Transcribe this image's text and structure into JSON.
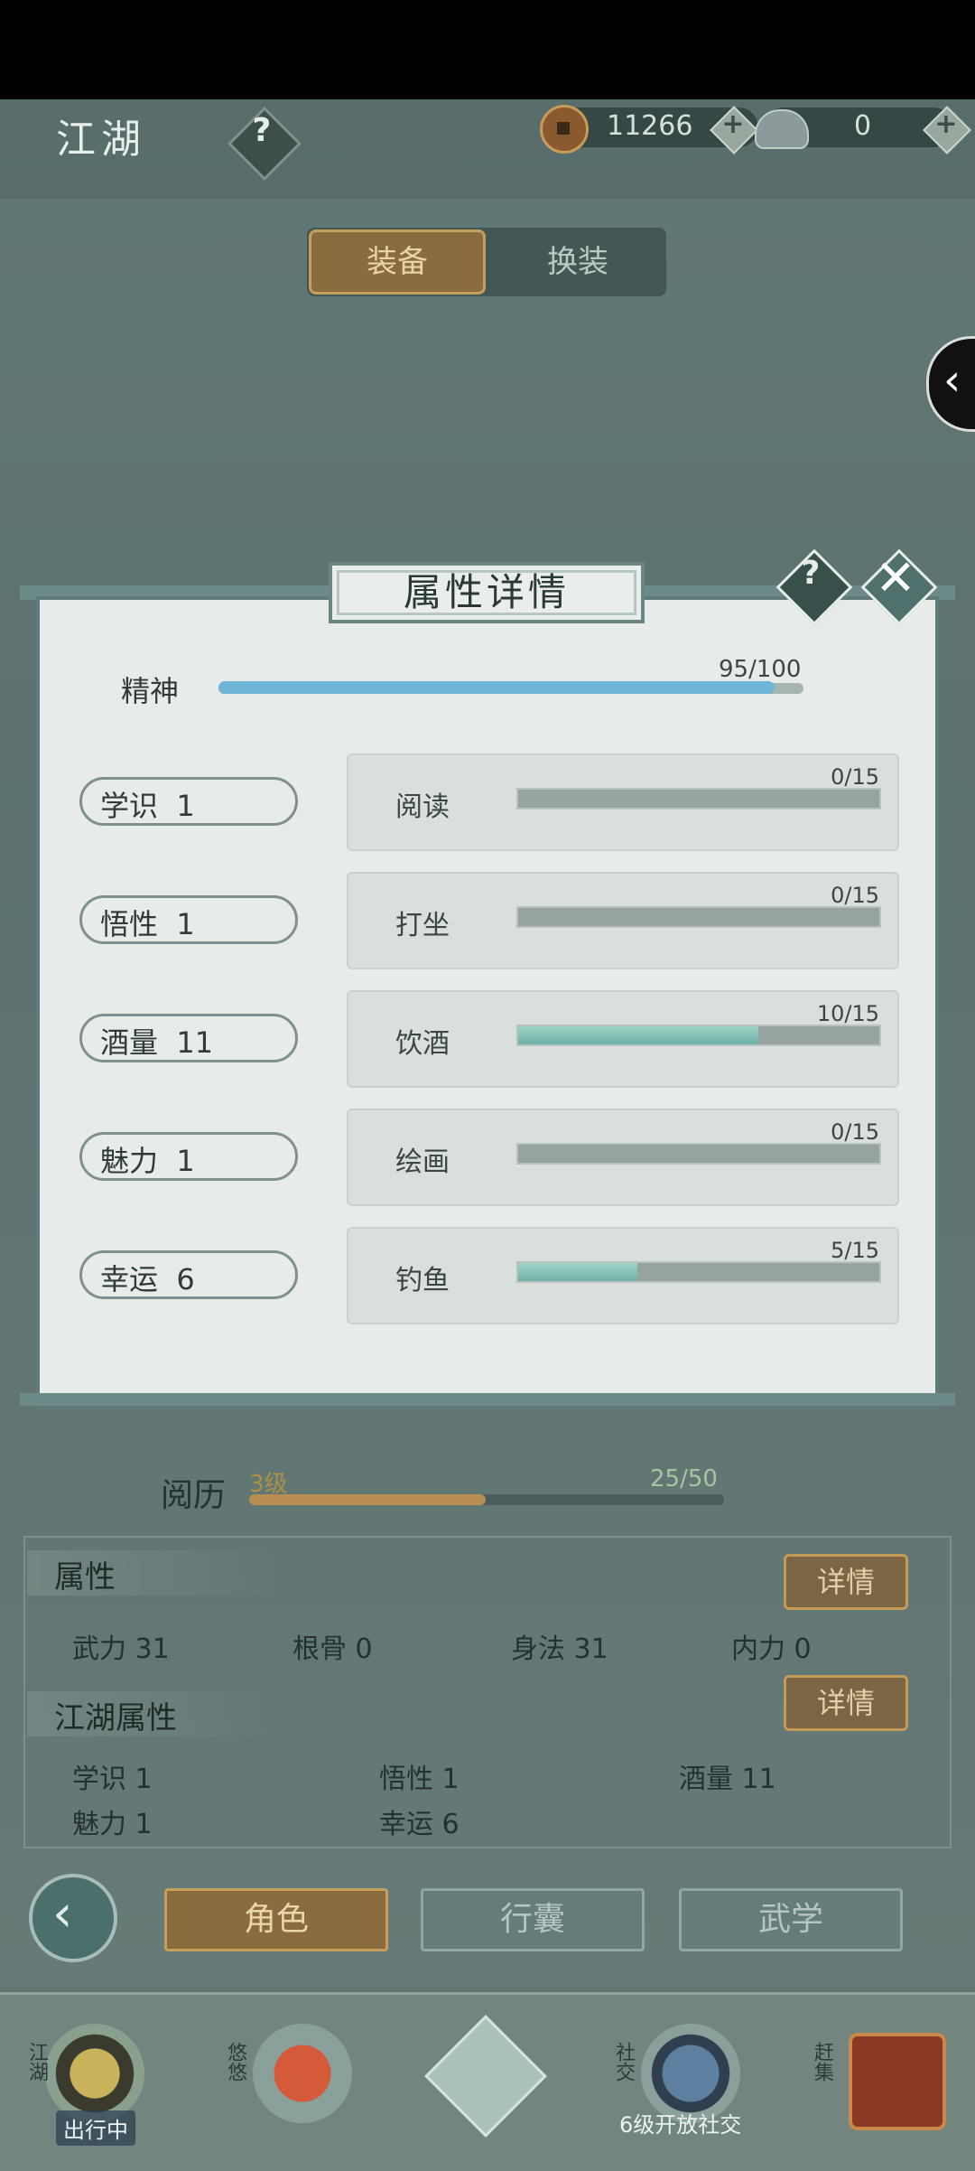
{
  "header": {
    "title": "江湖",
    "help": "?",
    "copper": "11266",
    "silver": "0",
    "add": "+"
  },
  "tabs": [
    {
      "label": "装备",
      "active": true
    },
    {
      "label": "换装",
      "active": false
    }
  ],
  "side_arrow": "‹",
  "dialog": {
    "title": "属性详情",
    "help": "?",
    "close": "✕",
    "spirit": {
      "label": "精神",
      "value": "95/100",
      "current": 95,
      "max": 100
    },
    "attributes": [
      {
        "name": "学识  1",
        "skill": "阅读",
        "progress": "0/15",
        "current": 0,
        "max": 15
      },
      {
        "name": "悟性  1",
        "skill": "打坐",
        "progress": "0/15",
        "current": 0,
        "max": 15
      },
      {
        "name": "酒量  11",
        "skill": "饮酒",
        "progress": "10/15",
        "current": 10,
        "max": 15
      },
      {
        "name": "魅力  1",
        "skill": "绘画",
        "progress": "0/15",
        "current": 0,
        "max": 15
      },
      {
        "name": "幸运  6",
        "skill": "钓鱼",
        "progress": "5/15",
        "current": 5,
        "max": 15
      }
    ]
  },
  "experience": {
    "label": "阅历",
    "level": "3级",
    "value": "25/50",
    "current": 25,
    "max": 50
  },
  "attributes_panel": {
    "title": "属性",
    "detail": "详情",
    "items": [
      "武力 31",
      "根骨 0",
      "身法 31",
      "内力 0"
    ],
    "jianghu_title": "江湖属性",
    "jianghu_detail": "详情",
    "jianghu_items": [
      "学识 1",
      "悟性 1",
      "酒量 11",
      "魅力 1",
      "幸运 6"
    ]
  },
  "actions": {
    "back": "‹",
    "buttons": [
      {
        "label": "角色",
        "active": true
      },
      {
        "label": "行囊",
        "active": false
      },
      {
        "label": "武学",
        "active": false
      }
    ]
  },
  "bottom_nav": [
    {
      "label": "江湖",
      "tag": "出行中"
    },
    {
      "label": "悠悠",
      "tag": ""
    },
    {
      "label": "",
      "tag": ""
    },
    {
      "label": "社交",
      "tag": "6级开放社交"
    },
    {
      "label": "赶集",
      "tag": ""
    }
  ],
  "colors": {
    "accent_gold": "#c49a57",
    "progress_teal": "#6fb0a6",
    "spirit_blue": "#6fb5d8"
  }
}
